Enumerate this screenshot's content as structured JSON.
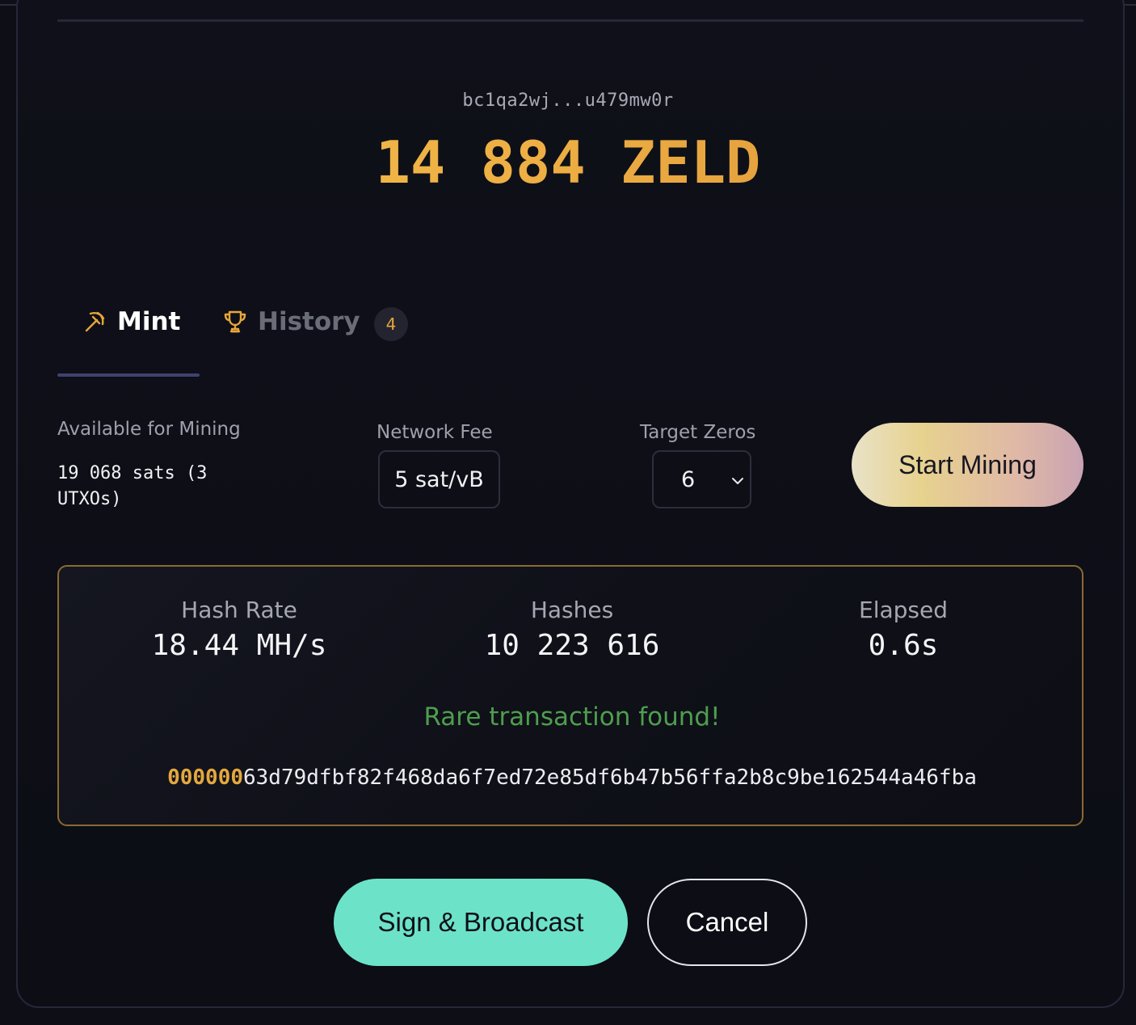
{
  "wallet": {
    "address": "bc1qa2wj...u479mw0r",
    "balance": "14 884 ZELD"
  },
  "tabs": [
    {
      "label": "Mint",
      "icon": "pickaxe-icon",
      "active": true
    },
    {
      "label": "History",
      "icon": "trophy-icon",
      "active": false,
      "badge": "4"
    }
  ],
  "mining": {
    "available_label": "Available for Mining",
    "available_value": "19 068 sats (3 UTXOs)",
    "fee_label": "Network Fee",
    "fee_value": "5 sat/vB",
    "zeros_label": "Target Zeros",
    "zeros_value": "6",
    "start_label": "Start Mining"
  },
  "stats": {
    "hash_rate_label": "Hash Rate",
    "hash_rate_value": "18.44 MH/s",
    "hashes_label": "Hashes",
    "hashes_value": "10 223 616",
    "elapsed_label": "Elapsed",
    "elapsed_value": "0.6s"
  },
  "result": {
    "message": "Rare transaction found!",
    "hash_prefix": "000000",
    "hash_rest": "63d79dfbf82f468da6f7ed72e85df6b47b56ffa2b8c9be162544a46fba"
  },
  "actions": {
    "sign_label": "Sign & Broadcast",
    "cancel_label": "Cancel"
  },
  "colors": {
    "accent_gold": "#e4a83e",
    "success_green": "#4e9e4e",
    "primary_button": "#6ce3c8"
  }
}
